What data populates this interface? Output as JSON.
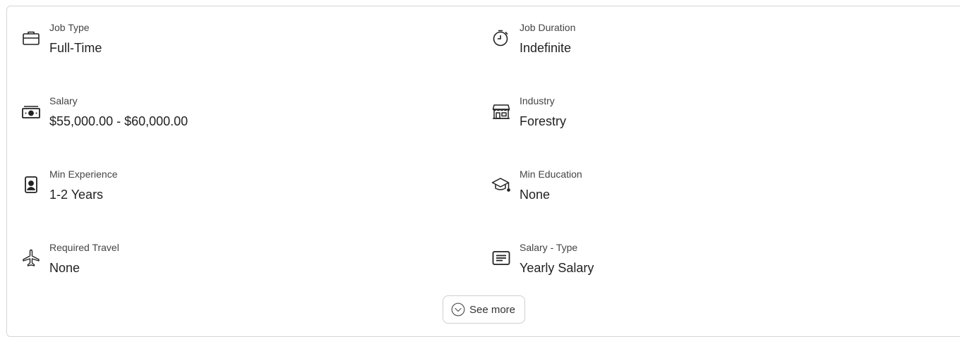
{
  "details": [
    {
      "label": "Job Type",
      "value": "Full-Time",
      "icon": "briefcase-icon"
    },
    {
      "label": "Job Duration",
      "value": "Indefinite",
      "icon": "stopwatch-icon"
    },
    {
      "label": "Salary",
      "value": "$55,000.00 - $60,000.00",
      "icon": "banknote-icon"
    },
    {
      "label": "Industry",
      "value": "Forestry",
      "icon": "storefront-icon"
    },
    {
      "label": "Min Experience",
      "value": "1-2 Years",
      "icon": "id-badge-icon"
    },
    {
      "label": "Min Education",
      "value": "None",
      "icon": "graduation-cap-icon"
    },
    {
      "label": "Required Travel",
      "value": "None",
      "icon": "airplane-icon"
    },
    {
      "label": "Salary - Type",
      "value": "Yearly Salary",
      "icon": "document-lines-icon"
    }
  ],
  "see_more_label": "See more"
}
